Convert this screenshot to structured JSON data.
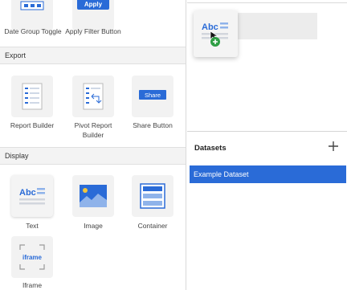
{
  "widgets_top_partial": [
    {
      "label": "Date Group Toggle"
    },
    {
      "label": "Apply Filter Button",
      "icon_text": "Apply"
    }
  ],
  "sections": {
    "export": {
      "title": "Export",
      "items": [
        {
          "label": "Report Builder"
        },
        {
          "label": "Pivot Report Builder"
        },
        {
          "label": "Share Button",
          "icon_text": "Share"
        }
      ]
    },
    "display": {
      "title": "Display",
      "items": [
        {
          "label": "Text",
          "icon_text": "Abc"
        },
        {
          "label": "Image"
        },
        {
          "label": "Container"
        },
        {
          "label": "Iframe",
          "icon_text": "iframe"
        }
      ]
    }
  },
  "canvas": {
    "drag_ghost_icon_text": "Abc"
  },
  "datasets": {
    "title": "Datasets",
    "add_icon": "plus-icon",
    "items": [
      {
        "label": "Example Dataset",
        "selected": true
      }
    ]
  },
  "colors": {
    "accent": "#2a6bd7",
    "panel_bg": "#ffffff",
    "tile_bg": "#f2f2f2",
    "section_bg": "#f3f3f3",
    "plus_green": "#2e9e44"
  }
}
